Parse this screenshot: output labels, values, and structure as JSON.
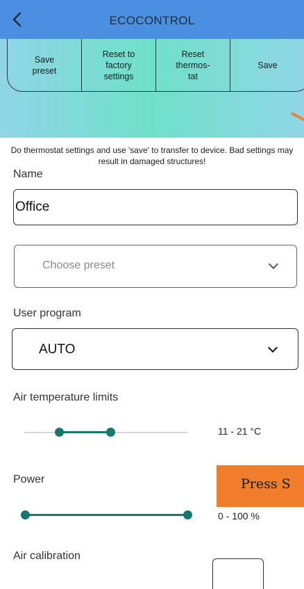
{
  "header": {
    "title": "ECOCONTROL"
  },
  "toolbar": {
    "buttons": [
      "Save\npreset",
      "Reset to\nfactory\nsettings",
      "Reset\nthermos-\ntat",
      "Save"
    ]
  },
  "notice": "Do thermostat settings and use 'save' to transfer to device. Bad settings may result in damaged structures!",
  "form": {
    "name_label": "Name",
    "name_value": "Office",
    "preset_placeholder": "Choose preset",
    "program_label": "User program",
    "program_value": "AUTO",
    "air_temp_label": "Air temperature limits",
    "air_temp_value": "11 - 21 °C",
    "power_label": "Power",
    "power_value": "0 - 100 %",
    "calibration_label": "Air calibration"
  },
  "sliders": {
    "air_temperature": {
      "low": 11,
      "high": 21
    },
    "power": {
      "low": 0,
      "high": 100
    }
  },
  "toast": {
    "text": "Press S"
  },
  "colors": {
    "header": "#4a8fe0",
    "accent": "#157a6e",
    "toast": "#ef7d2c"
  }
}
